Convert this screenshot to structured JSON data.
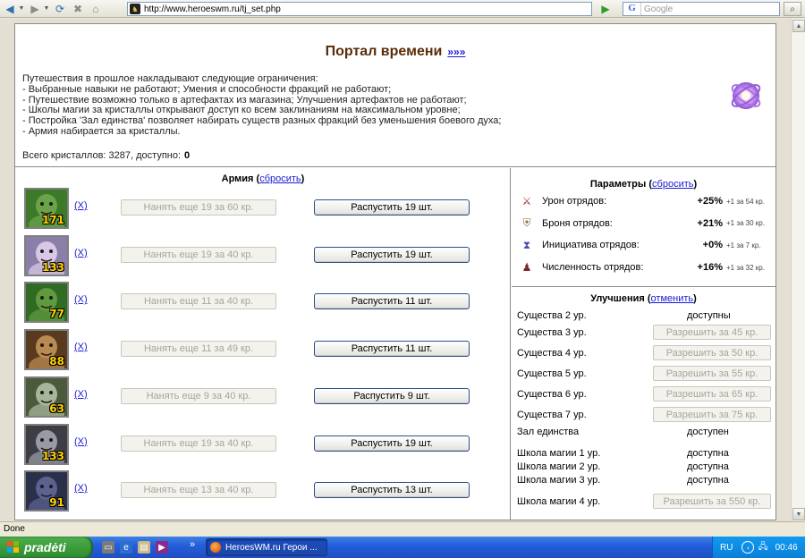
{
  "browser": {
    "url": "http://www.heroeswm.ru/tj_set.php",
    "search_placeholder": "Google",
    "search_engine_letter": "G"
  },
  "page": {
    "title": "Портал времени",
    "title_link": "»»»",
    "restrictions": [
      "Путешествия в прошлое накладывают следующие ограничения:",
      "- Выбранные навыки не работают; Умения и способности фракций не работают;",
      "- Путешествие возможно только в артефактах из магазина; Улучшения артефактов не работают;",
      "- Школы магии за кристаллы открывают доступ ко всем заклинаниям на максимальном уровне;",
      "- Постройка 'Зал единства' позволяет набирать существ разных фракций без уменьшения боевого духа;",
      "- Армия набирается за кристаллы."
    ],
    "crystals_text": "Всего кристаллов: 3287, доступно:",
    "crystals_available": "0"
  },
  "army": {
    "title": "Армия",
    "reset_label": "сбросить",
    "dismiss_label": "(X)",
    "units": [
      {
        "count": "171",
        "hire": "Нанять еще 19 за 60 кр.",
        "release": "Распустить 19 шт.",
        "color": "#3c7a2a",
        "skin": "#6aa348"
      },
      {
        "count": "133",
        "hire": "Нанять еще 19 за 40 кр.",
        "release": "Распустить 19 шт.",
        "color": "#8a7fa8",
        "skin": "#d8c8e6"
      },
      {
        "count": "77",
        "hire": "Нанять еще 11 за 40 кр.",
        "release": "Распустить 11 шт.",
        "color": "#2f6b25",
        "skin": "#5f9a3e"
      },
      {
        "count": "88",
        "hire": "Нанять еще 11 за 49 кр.",
        "release": "Распустить 11 шт.",
        "color": "#5a3a1e",
        "skin": "#b98952"
      },
      {
        "count": "63",
        "hire": "Нанять еще 9 за 40 кр.",
        "release": "Распустить 9 шт.",
        "color": "#4b5a3a",
        "skin": "#a7b59a"
      },
      {
        "count": "133",
        "hire": "Нанять еще 19 за 40 кр.",
        "release": "Распустить 19 шт.",
        "color": "#3d3d45",
        "skin": "#9a9aa6"
      },
      {
        "count": "91",
        "hire": "Нанять еще 13 за 40 кр.",
        "release": "Распустить 13 шт.",
        "color": "#2a2f4a",
        "skin": "#5b6290"
      }
    ]
  },
  "params": {
    "title": "Параметры",
    "reset_label": "сбросить",
    "rows": [
      {
        "name": "Урон отрядов:",
        "value": "+25%",
        "cost": "+1 за 54 кр.",
        "icon": "sword-icon",
        "glyph": "⚔",
        "color": "#b02020"
      },
      {
        "name": "Броня отрядов:",
        "value": "+21%",
        "cost": "+1 за 30 кр.",
        "icon": "shield-icon",
        "glyph": "⛨",
        "color": "#8a6a3a"
      },
      {
        "name": "Инициатива отрядов:",
        "value": "+0%",
        "cost": "+1 за 7 кр.",
        "icon": "initiative-icon",
        "glyph": "⧗",
        "color": "#4a4ab0"
      },
      {
        "name": "Численность отрядов:",
        "value": "+16%",
        "cost": "+1 за 32 кр.",
        "icon": "troops-icon",
        "glyph": "♟",
        "color": "#7a2a2a"
      }
    ]
  },
  "upgrades": {
    "title": "Улучшения",
    "cancel_label": "отменить",
    "rows": [
      {
        "name": "Существа 2 ур.",
        "status": "доступны",
        "button": ""
      },
      {
        "name": "Существа 3 ур.",
        "status": "",
        "button": "Разрешить за 45 кр."
      },
      {
        "name": "Существа 4 ур.",
        "status": "",
        "button": "Разрешить за 50 кр."
      },
      {
        "name": "Существа 5 ур.",
        "status": "",
        "button": "Разрешить за 55 кр."
      },
      {
        "name": "Существа 6 ур.",
        "status": "",
        "button": "Разрешить за 65 кр."
      },
      {
        "name": "Существа 7 ур.",
        "status": "",
        "button": "Разрешить за 75 кр."
      },
      {
        "name": "Зал единства",
        "status": "доступен",
        "button": ""
      },
      {
        "name": "Школа магии 1 ур.",
        "status": "доступна",
        "button": ""
      },
      {
        "name": "Школа магии 2 ур.",
        "status": "доступна",
        "button": ""
      },
      {
        "name": "Школа магии 3 ур.",
        "status": "доступна",
        "button": ""
      },
      {
        "name": "Школа магии 4 ур.",
        "status": "",
        "button": "Разрешить за 550 кр."
      }
    ]
  },
  "status_bar": {
    "text": "Done"
  },
  "taskbar": {
    "start_label": "pradėti",
    "task_label": "HeroesWM.ru Герои ...",
    "lang": "RU",
    "clock": "00:46"
  }
}
